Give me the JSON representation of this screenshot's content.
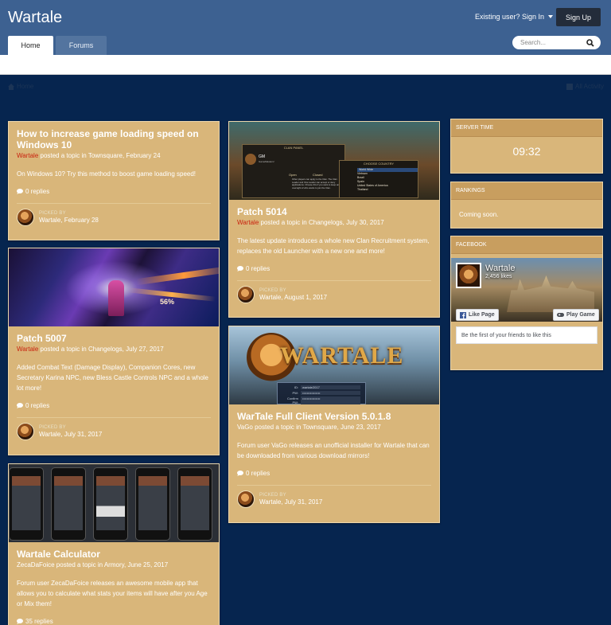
{
  "header": {
    "site_title": "Wartale",
    "signin_label": "Existing user? Sign In",
    "signup_label": "Sign Up",
    "tabs": [
      {
        "label": "Home",
        "active": true
      },
      {
        "label": "Forums",
        "active": false
      }
    ],
    "search_placeholder": "Search..."
  },
  "breadcrumb": {
    "home_label": "Home",
    "activity_label": "All Activity"
  },
  "cards": [
    {
      "title": "How to increase game loading speed on Windows 10",
      "author": "Wartale",
      "author_red": true,
      "meta_suffix": " posted a topic in Townsquare, February 24",
      "excerpt": "On Windows 10? Try this method to boost game loading speed!",
      "replies": "0 replies",
      "picked_label": "PICKED BY",
      "picked_by": "Wartale, February 28"
    },
    {
      "title": "Patch 5007",
      "author": "Wartale",
      "author_red": true,
      "meta_suffix": " posted a topic in Changelogs, July 27, 2017",
      "excerpt": "Added Combat Text (Damage Display), Companion Cores, new Secretary Karina NPC, new Bless Castle Controls NPC and a whole lot more!",
      "replies": "0 replies",
      "picked_label": "PICKED BY",
      "picked_by": "Wartale, July 31, 2017"
    },
    {
      "title": "Wartale Calculator",
      "author": "ZecaDaFoice",
      "author_red": false,
      "meta_suffix": " posted a topic in Armory, June 25, 2017",
      "excerpt": "Forum user ZecaDaFoice releases an awesome mobile app that allows you to calculate what stats your items will have after you Age or Mix them!",
      "replies": "35 replies"
    },
    {
      "title": "Patch 5014",
      "author": "Wartale",
      "author_red": true,
      "meta_suffix": " posted a topic in Changelogs, July 30, 2017",
      "excerpt": "The latest update introduces a whole new Clan Recruitment system, replaces the old Launcher with a new one and more!",
      "replies": "0 replies",
      "picked_label": "PICKED BY",
      "picked_by": "Wartale, August 1, 2017"
    },
    {
      "title": "WarTale Full Client Version 5.0.1.8",
      "author": "VaGo",
      "author_red": false,
      "meta_suffix": " posted a topic in Townsquare, June 23, 2017",
      "excerpt": "Forum user VaGo releases an unofficial installer for Wartale that can be downloaded from various download mirrors!",
      "replies": "0 replies",
      "picked_label": "PICKED BY",
      "picked_by": "Wartale, July 31, 2017"
    }
  ],
  "patch5014_image": {
    "panel_title": "CLAN PANEL",
    "gm_label": "GM",
    "gm_sub": "GameMasters!",
    "open_label": "Open",
    "closed_label": "Closed",
    "choose_country": "CHOOSE COUNTRY",
    "countries": [
      "World Wide",
      "Vietnam",
      "Brazil",
      "Spain",
      "United States of America",
      "Thailand"
    ],
    "panel_text": "Other players can apply to the Clan. The Clan Leader and Vice Leader can accept or deny applications. Choose this if you want to keep an oversight of who wants to join the Clan."
  },
  "client_image": {
    "logo_text": "WARTALE",
    "id_label": "ID:",
    "id_value": "wartale2017",
    "pw_label": "PW:",
    "pw_value": "••••••••••••••••",
    "confirm_label": "Confirm PW:",
    "confirm_value": "••••••••••••••••"
  },
  "patch5007_image": {
    "overlay_text": "56%"
  },
  "widgets": {
    "server_time": {
      "heading": "SERVER TIME",
      "value": "09:32"
    },
    "rankings": {
      "heading": "RANKINGS",
      "text": "Coming soon."
    },
    "facebook": {
      "heading": "FACEBOOK",
      "page_name": "Wartale",
      "likes": "2,456 likes",
      "like_button": "Like Page",
      "play_button": "Play Game",
      "friends_text": "Be the first of your friends to like this"
    }
  },
  "colors": {
    "background": "#06254f",
    "header": "#3d6191",
    "card": "#d9b67a",
    "card_header": "#c89e5f",
    "author_red": "#c9220f"
  }
}
